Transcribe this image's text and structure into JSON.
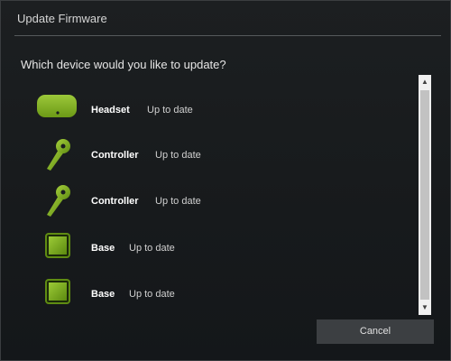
{
  "dialog": {
    "title": "Update Firmware",
    "prompt": "Which device would you like to update?",
    "cancel_label": "Cancel"
  },
  "devices": [
    {
      "name": "Headset",
      "status": "Up to date",
      "icon": "headset-icon"
    },
    {
      "name": "Controller",
      "status": "Up to date",
      "icon": "controller-icon"
    },
    {
      "name": "Controller",
      "status": "Up to date",
      "icon": "controller-icon"
    },
    {
      "name": "Base",
      "status": "Up to date",
      "icon": "base-station-icon"
    },
    {
      "name": "Base",
      "status": "Up to date",
      "icon": "base-station-icon"
    }
  ],
  "scrollbar": {
    "up_arrow": "▲",
    "down_arrow": "▼"
  },
  "colors": {
    "accent": "#7fb21f",
    "background": "#16191b",
    "button": "#3c3f42"
  }
}
